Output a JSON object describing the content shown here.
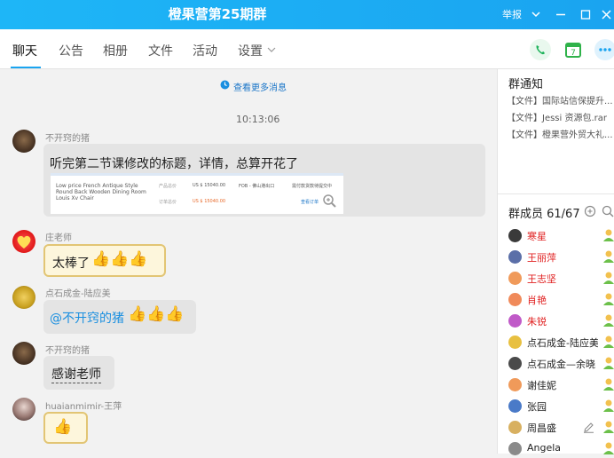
{
  "window": {
    "title": "橙果营第25期群",
    "report_label": "举报"
  },
  "tabs": [
    {
      "label": "聊天",
      "active": true
    },
    {
      "label": "公告"
    },
    {
      "label": "相册"
    },
    {
      "label": "文件"
    },
    {
      "label": "活动"
    },
    {
      "label": "设置"
    }
  ],
  "chat": {
    "more_label": "查看更多消息",
    "timestamp": "10:13:06",
    "messages": [
      {
        "sender": "不开窍的猪",
        "text": "听完第二节课修改的标题，详情，总算开花了",
        "card": {
          "product": "Low price French Antique Style Round Back Wooden Dining Room Louis Xv Chair",
          "product_total_label": "产品总价",
          "product_total": "US $ 15040.00",
          "order_total_label": "订单总价",
          "order_total": "US $ 15040.00",
          "terms": "FOB - 佛山港出口",
          "status": "需付款货款待提交中",
          "view_order": "查看订单"
        }
      },
      {
        "sender": "庄老师",
        "text": "太棒了"
      },
      {
        "sender": "点石成金-陆应美",
        "text": "@不开窍的猪"
      },
      {
        "sender": "不开窍的猪",
        "text": "感谢老师"
      },
      {
        "sender": "huaianmimir-王萍",
        "text": ""
      }
    ]
  },
  "side": {
    "notice_title": "群通知",
    "notices": [
      "【文件】国际站信保提升...",
      "【文件】Jessi 资源包.rar",
      "【文件】橙果营外贸大礼..."
    ],
    "members_title": "群成员 61/67",
    "members": [
      {
        "name": "寒星",
        "color": "#e02020"
      },
      {
        "name": "王丽萍",
        "color": "#e02020"
      },
      {
        "name": "王志坚",
        "color": "#e02020"
      },
      {
        "name": "肖艳",
        "color": "#e02020"
      },
      {
        "name": "朱锐",
        "color": "#e02020"
      },
      {
        "name": "点石成金-陆应美",
        "color": "#222222"
      },
      {
        "name": "点石成金—余晓",
        "color": "#222222"
      },
      {
        "name": "谢佳妮",
        "color": "#222222"
      },
      {
        "name": "张园",
        "color": "#222222"
      },
      {
        "name": "周昌盛",
        "color": "#222222"
      },
      {
        "name": "Angela",
        "color": "#222222"
      }
    ]
  }
}
